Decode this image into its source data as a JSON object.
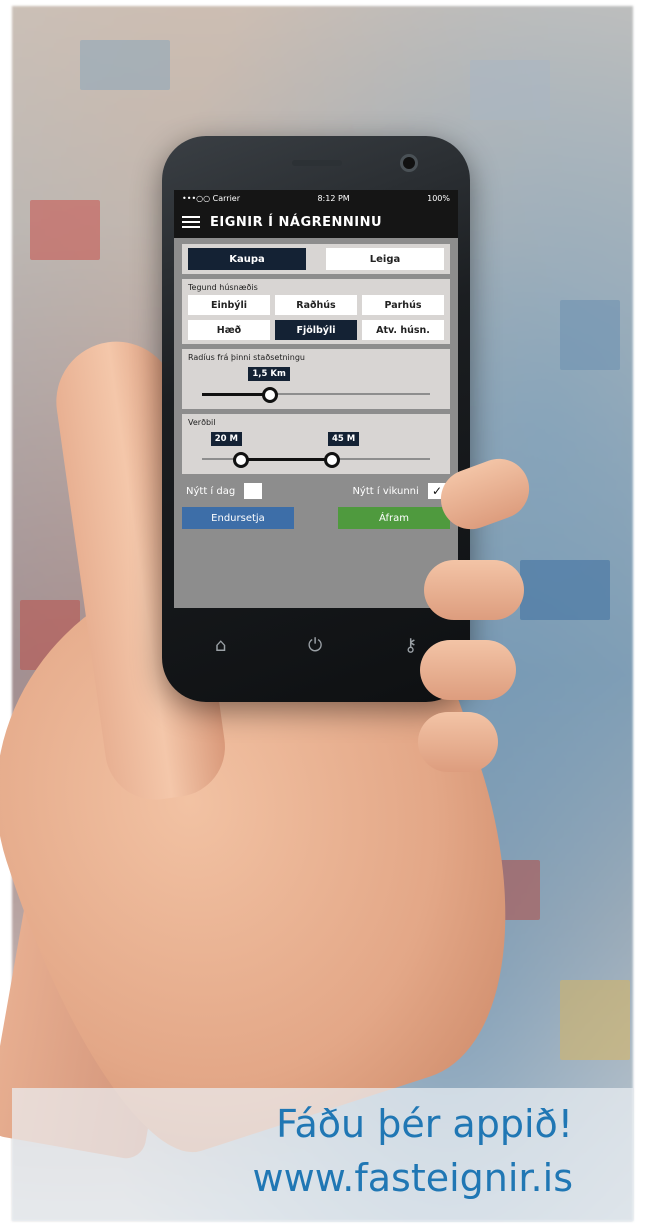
{
  "status_bar": {
    "carrier": "•••○○ Carrier",
    "time": "8:12 PM",
    "battery": "100%"
  },
  "app_bar": {
    "title": "EIGNIR Í NÁGRENNINU"
  },
  "mode": {
    "buy": "Kaupa",
    "rent": "Leiga",
    "selected": "Kaupa"
  },
  "property_type": {
    "label": "Tegund húsnæðis",
    "options": [
      "Einbýli",
      "Raðhús",
      "Parhús",
      "Hæð",
      "Fjölbýli",
      "Atv. húsn."
    ],
    "selected": "Fjölbýli"
  },
  "radius": {
    "label": "Radíus frá þinni staðsetningu",
    "value": "1,5 Km",
    "fraction": 0.3
  },
  "price": {
    "label": "Verðbil",
    "min": "20 M",
    "max": "45 M",
    "min_fraction": 0.17,
    "max_fraction": 0.57
  },
  "filters": {
    "new_today": "Nýtt í dag",
    "new_week": "Nýtt í vikunni",
    "new_today_checked": false,
    "new_week_checked": true
  },
  "actions": {
    "reset": "Endursetja",
    "continue": "Áfram"
  },
  "nav": {
    "home_icon": "home-icon",
    "power_icon": "power-icon",
    "key_icon": "key-icon"
  },
  "caption": {
    "line1": "Fáðu þér appið!",
    "line2": "www.fasteignir.is"
  },
  "colors": {
    "dark_navy": "#142234",
    "reset_blue": "#3d6ea8",
    "continue_green": "#4f9a3e",
    "caption_blue": "#2077b4"
  }
}
